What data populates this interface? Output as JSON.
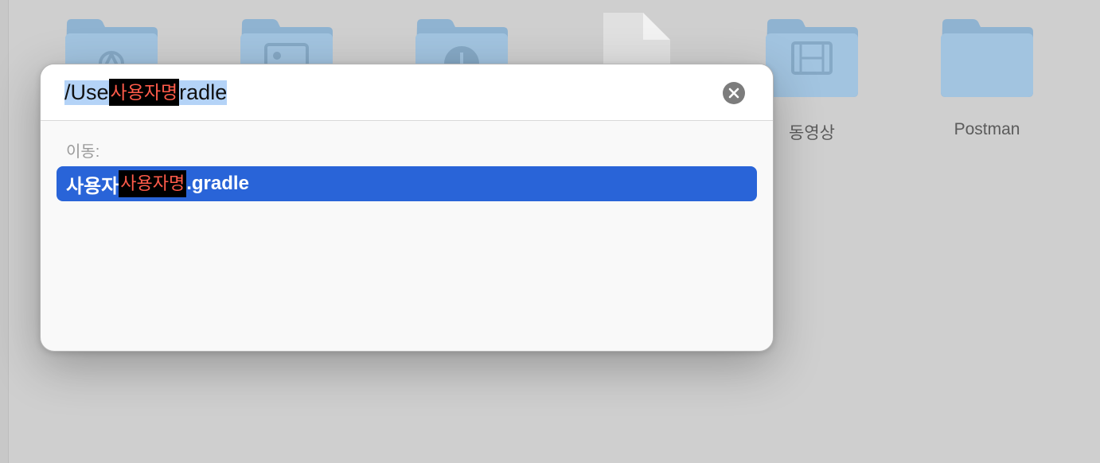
{
  "background": {
    "folders": [
      {
        "name": "applications-folder",
        "icon": "applications-folder-icon",
        "label": ""
      },
      {
        "name": "pictures-folder",
        "icon": "pictures-folder-icon",
        "label": ""
      },
      {
        "name": "downloads-folder",
        "icon": "downloads-folder-icon",
        "label": ""
      },
      {
        "name": "document-file",
        "icon": "document-file-icon",
        "label": ""
      },
      {
        "name": "movies-folder",
        "icon": "movies-folder-icon",
        "label": "동영상"
      },
      {
        "name": "postman-folder",
        "icon": "folder-icon",
        "label": "Postman"
      }
    ]
  },
  "goto": {
    "path_prefix": "/Use",
    "path_redacted": "사용자명",
    "path_suffix": "radle",
    "section_label": "이동:",
    "result_prefix": "사용자",
    "result_redacted": "사용자명",
    "result_suffix": ".gradle",
    "clear_icon": "clear-icon"
  },
  "colors": {
    "selection_highlight": "#2964d8",
    "text_selection": "#b4d3f7",
    "folder": "#9fc3de",
    "redaction_text": "#ff5b4a"
  }
}
